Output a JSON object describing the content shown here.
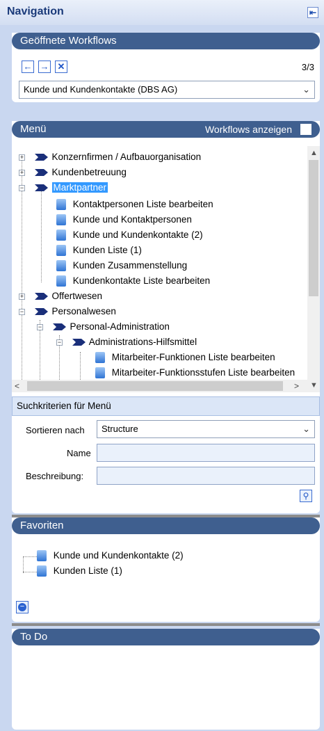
{
  "header": {
    "title": "Navigation"
  },
  "workflows": {
    "title": "Geöffnete Workflows",
    "count": "3/3",
    "selected": "Kunde und Kundenkontakte (DBS AG)"
  },
  "menu": {
    "title": "Menü",
    "show_workflows_label": "Workflows anzeigen",
    "tree": [
      "Konzernfirmen / Aufbauorganisation",
      "Kundenbetreuung",
      "Marktpartner",
      "Kontaktpersonen Liste bearbeiten",
      "Kunde und Kontaktpersonen",
      "Kunde und Kundenkontakte (2)",
      "Kunden Liste (1)",
      "Kunden Zusammenstellung",
      "Kundenkontakte Liste bearbeiten",
      "Offertwesen",
      "Personalwesen",
      "Personal-Administration",
      "Administrations-Hilfsmittel",
      "Mitarbeiter-Funktionen Liste bearbeiten",
      "Mitarbeiter-Funktionsstufen Liste bearbeiten"
    ]
  },
  "search": {
    "title": "Suchkriterien für Menü",
    "sort_label": "Sortieren nach",
    "sort_value": "Structure",
    "name_label": "Name",
    "desc_label": "Beschreibung:"
  },
  "favorites": {
    "title": "Favoriten",
    "items": [
      "Kunde und Kundenkontakte (2)",
      "Kunden Liste (1)"
    ]
  },
  "todo": {
    "title": "To Do"
  }
}
